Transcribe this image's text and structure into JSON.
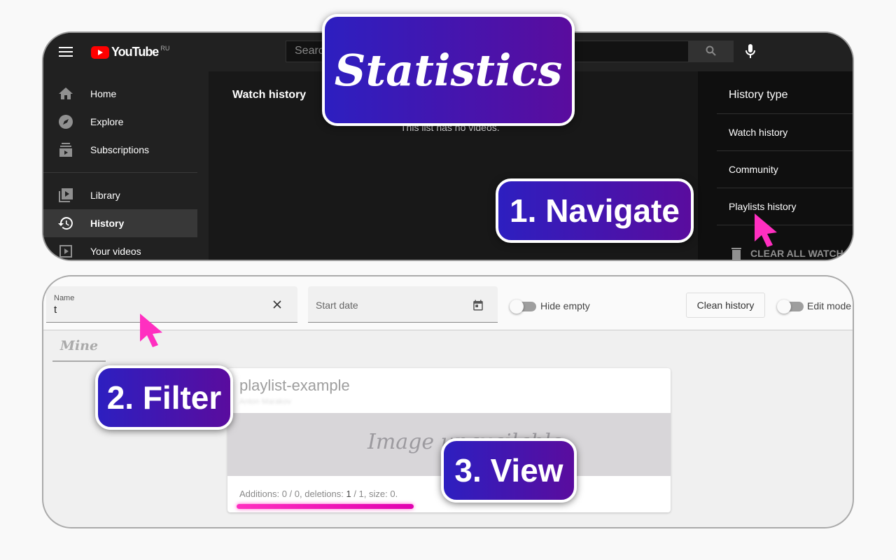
{
  "youtube": {
    "logo_text": "YouTube",
    "region": "RU",
    "search_placeholder": "Search",
    "sidebar": [
      {
        "label": "Home",
        "icon": "home-icon"
      },
      {
        "label": "Explore",
        "icon": "compass-icon"
      },
      {
        "label": "Subscriptions",
        "icon": "subscriptions-icon"
      },
      {
        "label": "Library",
        "icon": "library-icon"
      },
      {
        "label": "History",
        "icon": "history-icon",
        "active": true
      },
      {
        "label": "Your videos",
        "icon": "your-videos-icon"
      }
    ],
    "main_title": "Watch history",
    "empty_text": "This list has no videos.",
    "history_type": {
      "title": "History type",
      "items": [
        "Watch history",
        "Community",
        "Playlists history"
      ],
      "clear_label": "CLEAR ALL WATCH HISTORY"
    }
  },
  "badges": {
    "statistics": "Statistics",
    "navigate": "1. Navigate",
    "filter": "2. Filter",
    "view": "3. View"
  },
  "extension": {
    "name_label": "Name",
    "name_value": "t",
    "start_date_placeholder": "Start date",
    "hide_empty_label": "Hide empty",
    "hide_empty": false,
    "clean_history_label": "Clean history",
    "edit_mode_label": "Edit mode",
    "edit_mode": false,
    "tab": "Mine",
    "card": {
      "title": "playlist-example",
      "subtitle": "Anton Marakov",
      "image_text": "Image unavailable",
      "stats_prefix": "Additions: 0 / 0, deletions: ",
      "deletions_bold": "1",
      "stats_suffix": " / 1, size: 0."
    }
  },
  "colors": {
    "accent_cursor": "#ff2fc0",
    "badge_start": "#2d1fc0",
    "badge_end": "#5a0c9e",
    "youtube_red": "#ff0000"
  }
}
